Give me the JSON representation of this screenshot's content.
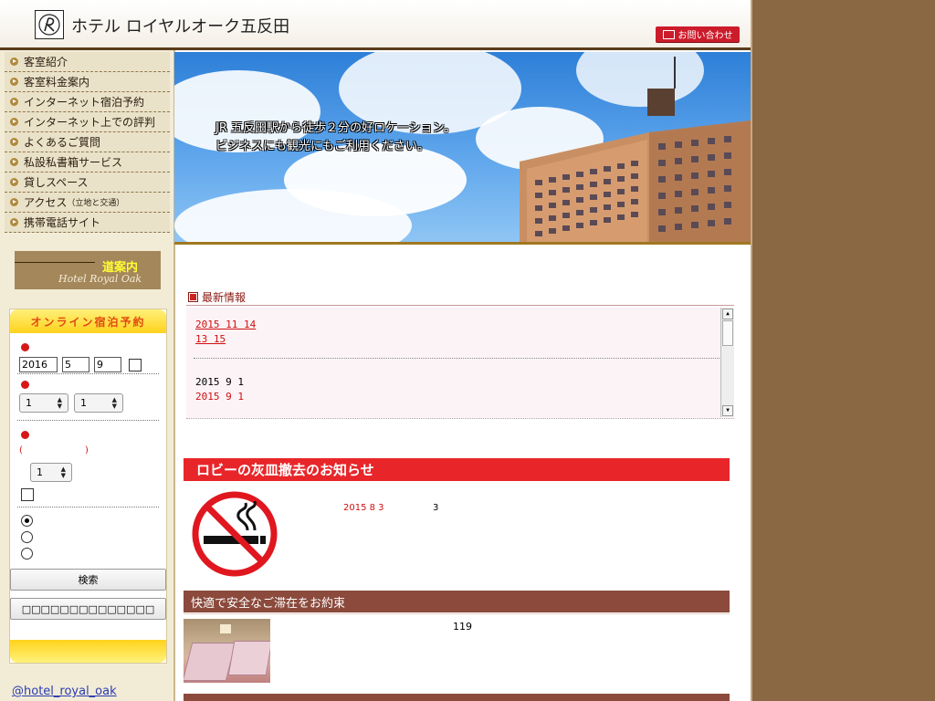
{
  "header": {
    "site_title": "ホテル ロイヤルオーク五反田",
    "contact_label": "お問い合わせ"
  },
  "sidebar": {
    "nav_items": [
      {
        "label": "客室紹介"
      },
      {
        "label": "客室料金案内"
      },
      {
        "label": "インターネット宿泊予約"
      },
      {
        "label": "インターネット上での評判"
      },
      {
        "label": "よくあるご質問"
      },
      {
        "label": "私設私書箱サービス"
      },
      {
        "label": "貸しスペース"
      },
      {
        "label": "アクセス",
        "small": "（立地と交通）"
      },
      {
        "label": "携帯電話サイト"
      }
    ],
    "map_banner": {
      "title": "道案内",
      "subtitle": "Hotel Royal Oak"
    },
    "booking": {
      "title": "オンライン宿泊予約",
      "year": "2016",
      "month": "5",
      "day": "9",
      "nights": "1",
      "rooms": "1",
      "paren_open": "(",
      "paren_close": ")",
      "guests": "1",
      "radio_selected_index": 0,
      "submit_label": "検索",
      "second_label": "□□□□□□□□□□□□□□"
    },
    "twitter_label": "@hotel_royal_oak"
  },
  "hero": {
    "caption_line1": "JR 五反田駅から徒歩２分の好ロケーション。",
    "caption_line2": "ビジネスにも観光にもご利用ください。"
  },
  "news": {
    "title": "最新情報",
    "items": [
      {
        "date": "2015 11 14",
        "style": "link"
      },
      {
        "date": "13  15",
        "style": "link"
      },
      {
        "date": "2015 9 1",
        "style": "plain"
      },
      {
        "date": "2015 9 1",
        "style": "red"
      }
    ]
  },
  "notice": {
    "title": "ロビーの灰皿撤去のお知らせ",
    "date": "2015 8 3",
    "number": "3"
  },
  "section2": {
    "title": "快適で安全なご滞在をお約束",
    "number": "119"
  },
  "colors": {
    "brand_brown": "#8b6844",
    "accent_red": "#e8262a",
    "section_brown": "#8b4a3c"
  }
}
